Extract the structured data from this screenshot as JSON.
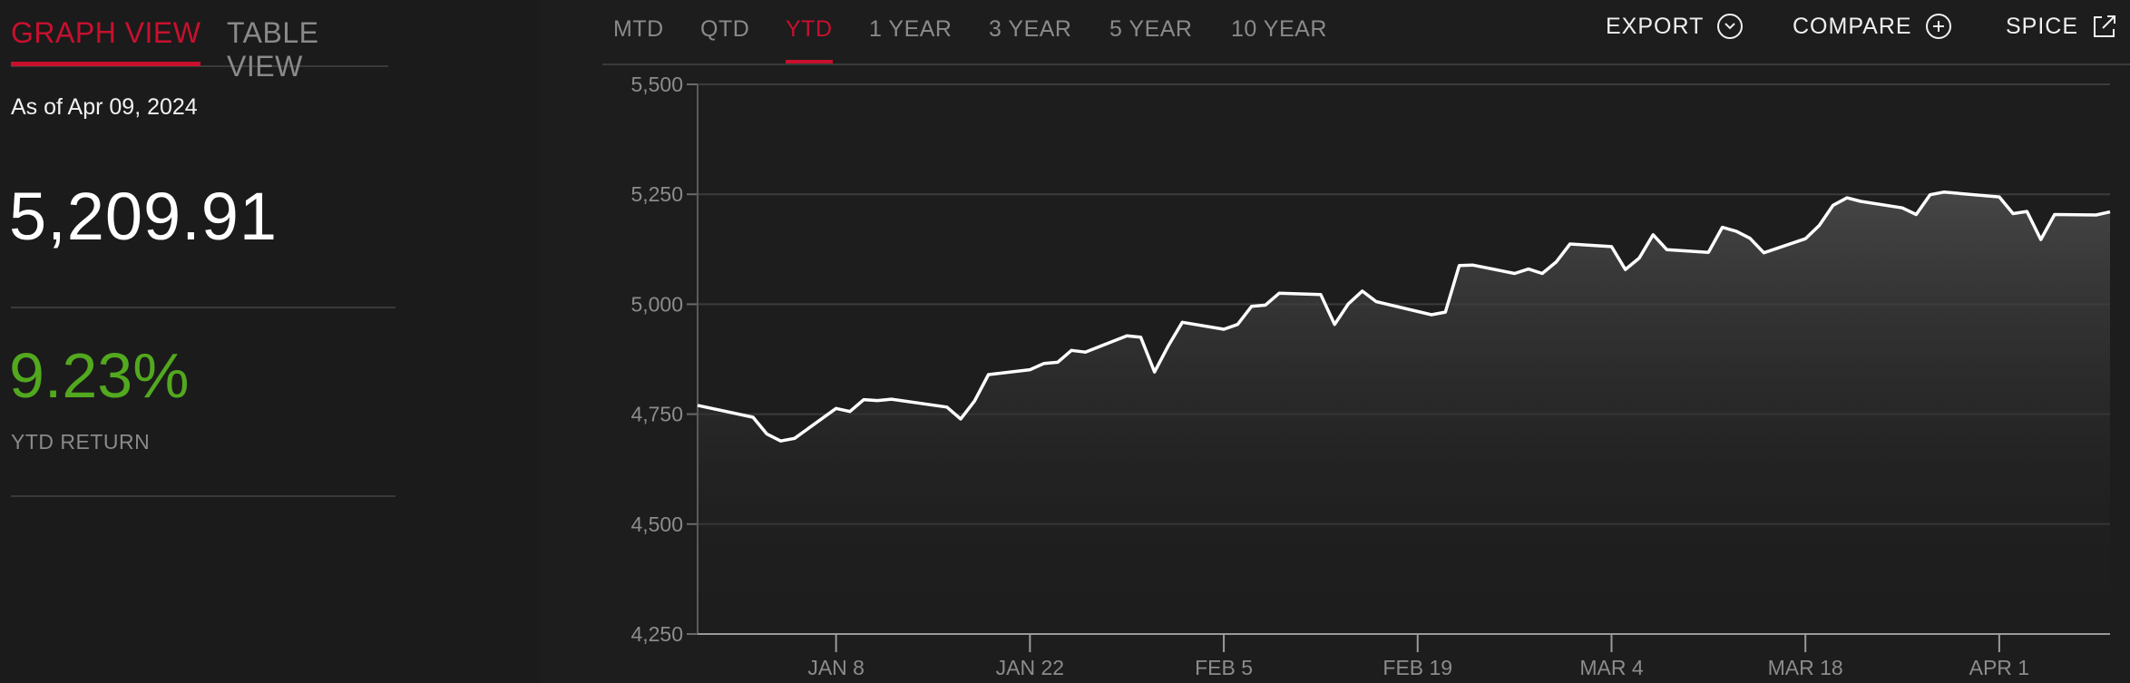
{
  "view_tabs": {
    "graph_label": "GRAPH VIEW",
    "table_label": "TABLE VIEW"
  },
  "summary": {
    "as_of": "As of Apr 09, 2024",
    "value": "5,209.91",
    "return_value": "9.23%",
    "return_label": "YTD RETURN"
  },
  "periods": [
    "MTD",
    "QTD",
    "YTD",
    "1 YEAR",
    "3 YEAR",
    "5 YEAR",
    "10 YEAR"
  ],
  "active_period": "YTD",
  "actions": {
    "export_label": "EXPORT",
    "compare_label": "COMPARE",
    "spice_label": "SPICE"
  },
  "colors": {
    "accent": "#c8102e",
    "positive": "#52a81e",
    "line": "#ffffff",
    "background": "#1d1d1d"
  },
  "chart_data": {
    "type": "area",
    "title": "",
    "xlabel": "",
    "ylabel": "",
    "ylim": [
      4250,
      5500
    ],
    "y_ticks": [
      4250,
      4500,
      4750,
      5000,
      5250,
      5500
    ],
    "y_tick_labels": [
      "4,250",
      "4,500",
      "4,750",
      "5,000",
      "5,250",
      "5,500"
    ],
    "x_ticks": [
      {
        "date": "2024-01-08",
        "label": "JAN 8"
      },
      {
        "date": "2024-01-22",
        "label": "JAN 22"
      },
      {
        "date": "2024-02-05",
        "label": "FEB 5"
      },
      {
        "date": "2024-02-19",
        "label": "FEB 19"
      },
      {
        "date": "2024-03-04",
        "label": "MAR 4"
      },
      {
        "date": "2024-03-18",
        "label": "MAR 18"
      },
      {
        "date": "2024-04-01",
        "label": "APR 1"
      }
    ],
    "xlim": [
      "2023-12-29",
      "2024-04-09"
    ],
    "grid": true,
    "series": [
      {
        "name": "",
        "x": [
          "2023-12-29",
          "2024-01-02",
          "2024-01-03",
          "2024-01-04",
          "2024-01-05",
          "2024-01-08",
          "2024-01-09",
          "2024-01-10",
          "2024-01-11",
          "2024-01-12",
          "2024-01-16",
          "2024-01-17",
          "2024-01-18",
          "2024-01-19",
          "2024-01-22",
          "2024-01-23",
          "2024-01-24",
          "2024-01-25",
          "2024-01-26",
          "2024-01-29",
          "2024-01-30",
          "2024-01-31",
          "2024-02-01",
          "2024-02-02",
          "2024-02-05",
          "2024-02-06",
          "2024-02-07",
          "2024-02-08",
          "2024-02-09",
          "2024-02-12",
          "2024-02-13",
          "2024-02-14",
          "2024-02-15",
          "2024-02-16",
          "2024-02-20",
          "2024-02-21",
          "2024-02-22",
          "2024-02-23",
          "2024-02-26",
          "2024-02-27",
          "2024-02-28",
          "2024-02-29",
          "2024-03-01",
          "2024-03-04",
          "2024-03-05",
          "2024-03-06",
          "2024-03-07",
          "2024-03-08",
          "2024-03-11",
          "2024-03-12",
          "2024-03-13",
          "2024-03-14",
          "2024-03-15",
          "2024-03-18",
          "2024-03-19",
          "2024-03-20",
          "2024-03-21",
          "2024-03-22",
          "2024-03-25",
          "2024-03-26",
          "2024-03-27",
          "2024-03-28",
          "2024-04-01",
          "2024-04-02",
          "2024-04-03",
          "2024-04-04",
          "2024-04-05",
          "2024-04-08",
          "2024-04-09"
        ],
        "y": [
          4770,
          4743,
          4705,
          4689,
          4695,
          4763,
          4756,
          4783,
          4781,
          4784,
          4766,
          4739,
          4780,
          4840,
          4851,
          4865,
          4868,
          4895,
          4891,
          4928,
          4925,
          4846,
          4906,
          4959,
          4943,
          4954,
          4995,
          4998,
          5025,
          5022,
          4954,
          5001,
          5030,
          5006,
          4976,
          4982,
          5088,
          5089,
          5070,
          5080,
          5070,
          5096,
          5137,
          5131,
          5079,
          5105,
          5158,
          5124,
          5118,
          5175,
          5166,
          5150,
          5117,
          5149,
          5179,
          5225,
          5242,
          5234,
          5219,
          5204,
          5249,
          5255,
          5244,
          5206,
          5211,
          5147,
          5204,
          5203,
          5210
        ]
      }
    ]
  }
}
